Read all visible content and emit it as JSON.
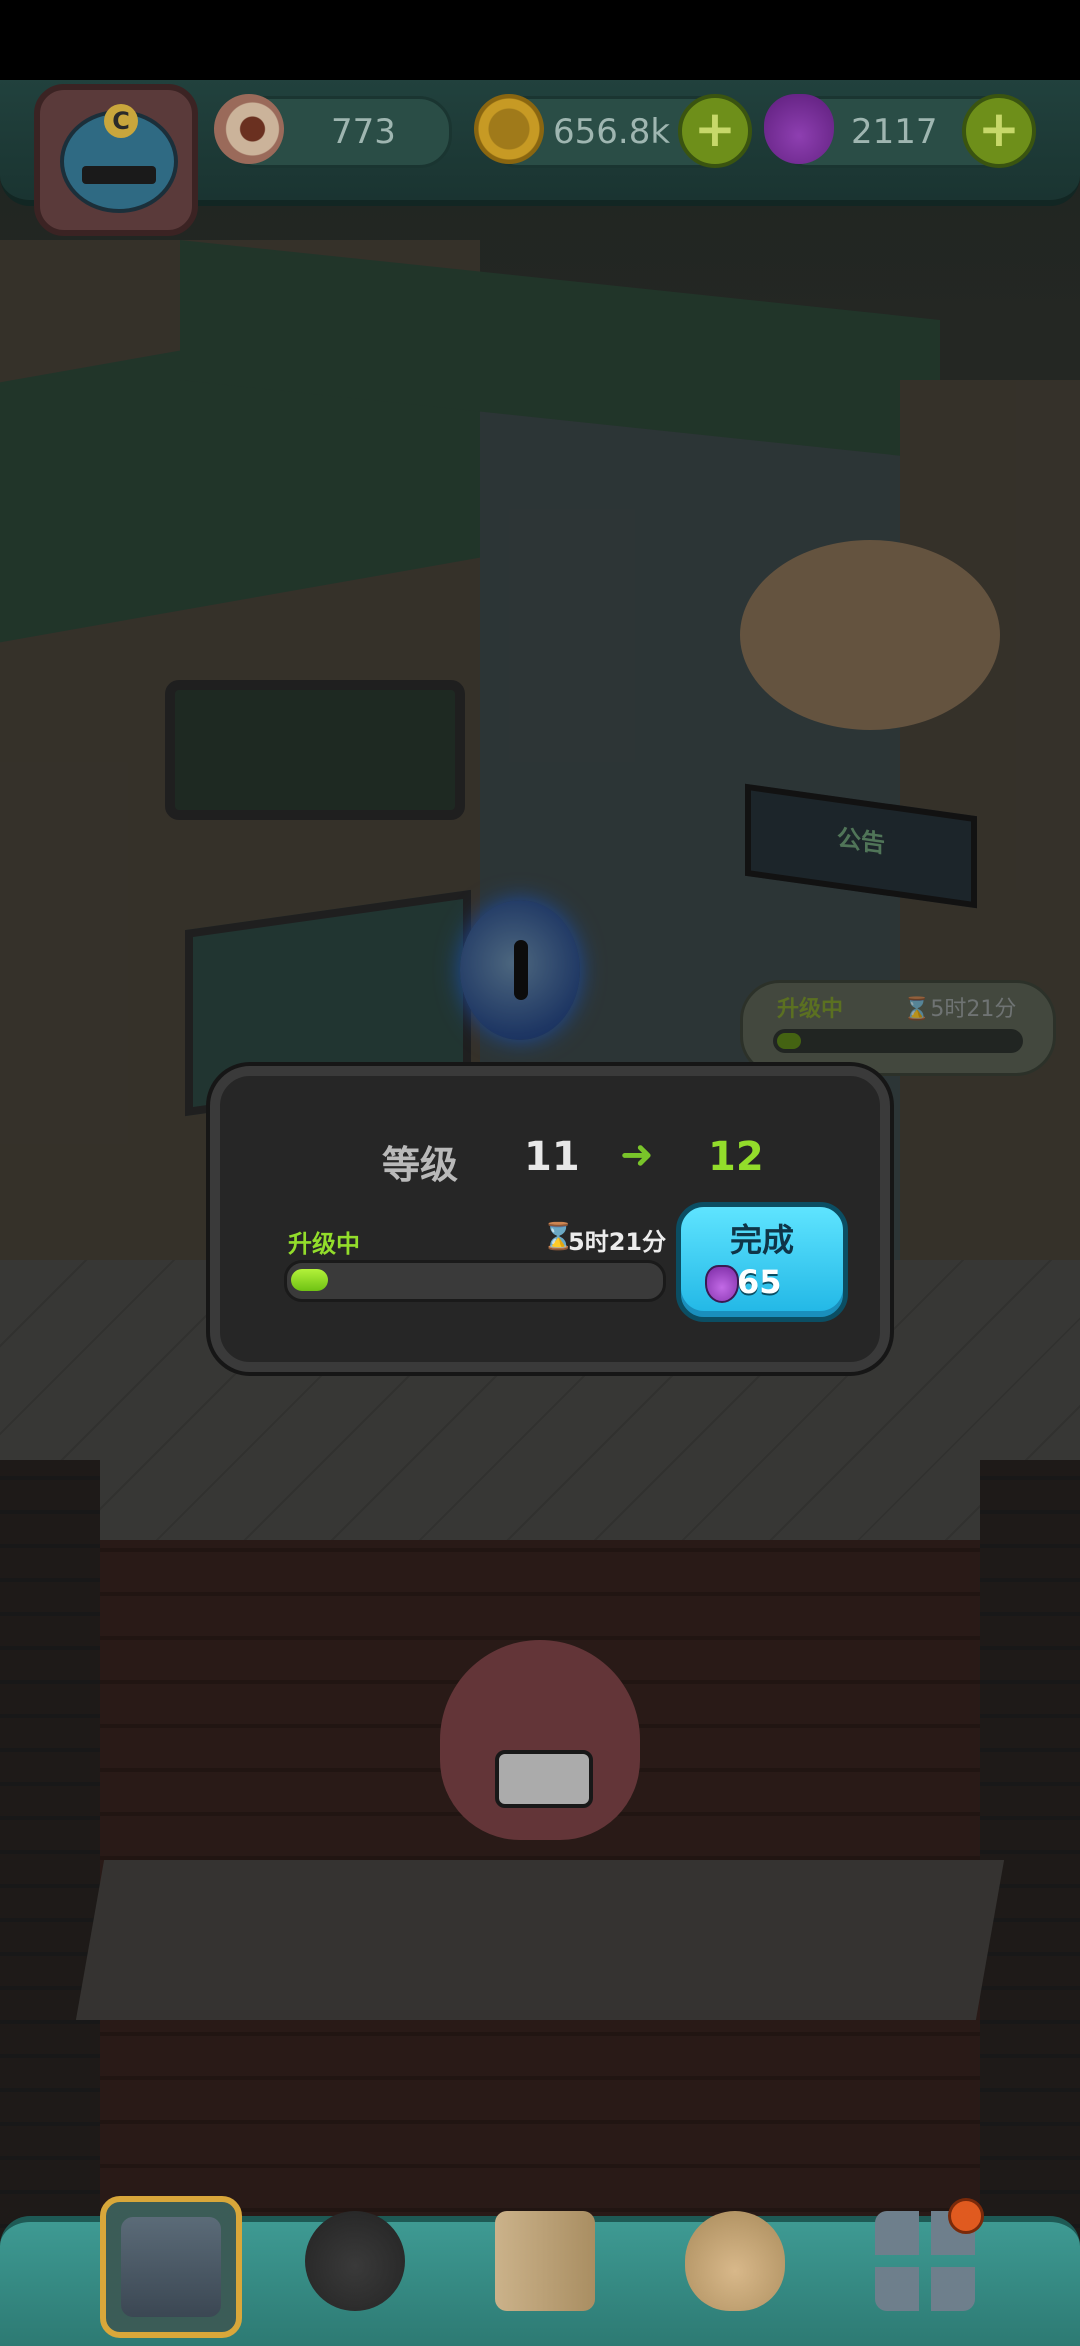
{
  "resources": {
    "eyes": "773",
    "coins": "656.8k",
    "potions": "2117"
  },
  "avatar": {
    "badge": "C"
  },
  "building_sign": "公告",
  "building_upgrade_tag": {
    "status": "升级中",
    "time": "5时21分",
    "progress": 0.1
  },
  "upgrade_dialog": {
    "level_label": "等级",
    "level_from": "11",
    "arrow": "➜",
    "level_to": "12",
    "status": "升级中",
    "timer_icon": "hourglass-icon",
    "time_remaining": "5时21分",
    "progress": 0.1,
    "finish_button": {
      "label": "完成",
      "cost": "65",
      "cost_icon": "potion-icon"
    }
  },
  "bottom_nav": [
    {
      "name": "shop",
      "icon": "shop-icon",
      "active": true
    },
    {
      "name": "monsters",
      "icon": "monster-icon",
      "active": false
    },
    {
      "name": "recipes",
      "icon": "book-icon",
      "active": false
    },
    {
      "name": "bag",
      "icon": "coin-bag-icon",
      "active": false
    },
    {
      "name": "menu",
      "icon": "grid-menu-icon",
      "active": false,
      "notification": true
    }
  ],
  "colors": {
    "accent_green": "#93dd2b",
    "finish_button": "#20b6e5",
    "topbar": "#21413d",
    "bottombar": "#3e9a93"
  }
}
